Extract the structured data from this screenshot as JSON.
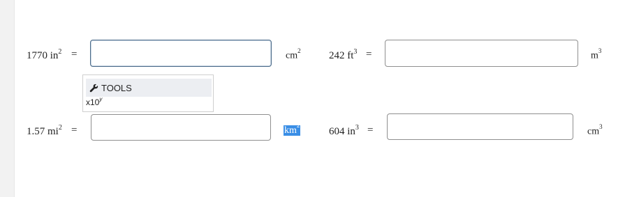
{
  "problems": [
    {
      "value": "1770",
      "from_unit": "in",
      "from_exp": "2",
      "equals": "=",
      "answer": "",
      "to_unit": "cm",
      "to_exp": "2"
    },
    {
      "value": "242",
      "from_unit": "ft",
      "from_exp": "3",
      "equals": "=",
      "answer": "",
      "to_unit": "m",
      "to_exp": "3"
    },
    {
      "value": "1.57",
      "from_unit": "mi",
      "from_exp": "2",
      "equals": "=",
      "answer": "",
      "to_unit": "km",
      "to_exp": "2"
    },
    {
      "value": "604",
      "from_unit": "in",
      "from_exp": "3",
      "equals": "=",
      "answer": "",
      "to_unit": "cm",
      "to_exp": "3"
    }
  ],
  "tools_menu": {
    "header_label": "TOOLS",
    "header_icon": "wrench-icon",
    "item_base": "x10",
    "item_exp": "y"
  },
  "colors": {
    "selection": "#3a8ee6",
    "focus_border": "#4a6a88"
  }
}
